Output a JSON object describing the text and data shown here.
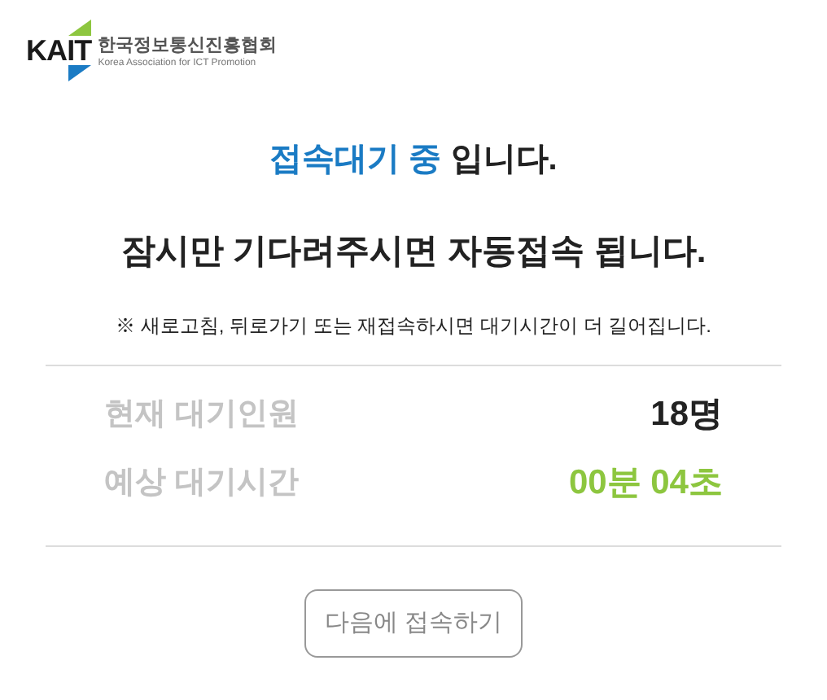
{
  "logo": {
    "mark": "KAIT",
    "name": "한국정보통신진흥협회",
    "subtitle": "Korea Association for ICT Promotion"
  },
  "heading": {
    "highlight": "접속대기 중",
    "rest": "입니다."
  },
  "message": "잠시만 기다려주시면 자동접속 됩니다.",
  "notice": "※ 새로고침, 뒤로가기 또는 재접속하시면 대기시간이 더 길어집니다.",
  "stats": [
    {
      "label": "현재 대기인원",
      "value": "18명",
      "kind": "count"
    },
    {
      "label": "예상 대기시간",
      "value": "00분 04초",
      "kind": "time"
    }
  ],
  "button": "다음에 접속하기"
}
